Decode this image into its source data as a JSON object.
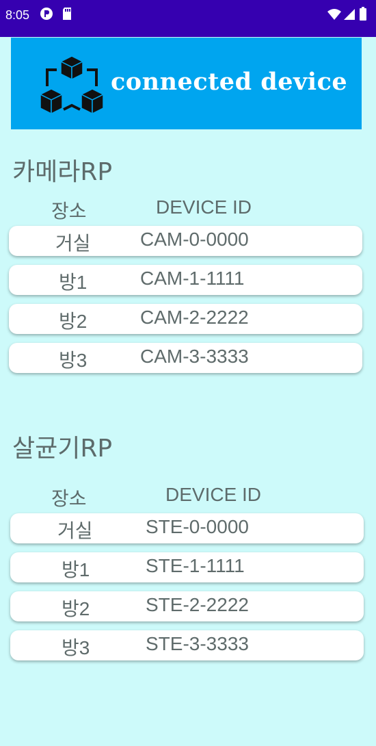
{
  "status_bar": {
    "time": "8:05",
    "icons": [
      "notification-icon",
      "sd-card-icon",
      "wifi-icon",
      "signal-icon",
      "battery-icon"
    ]
  },
  "banner": {
    "title": "connected device",
    "logo_icon": "network-cubes-icon",
    "background": "#00a5ef"
  },
  "camera": {
    "title": "카메라RP",
    "col_place": "장소",
    "col_device": "DEVICE ID",
    "rows": [
      {
        "place": "거실",
        "device": "CAM-0-0000"
      },
      {
        "place": "방1",
        "device": "CAM-1-1111"
      },
      {
        "place": "방2",
        "device": "CAM-2-2222"
      },
      {
        "place": "방3",
        "device": "CAM-3-3333"
      }
    ]
  },
  "sterilizer": {
    "title": "살균기RP",
    "col_place": "장소",
    "col_device": "DEVICE ID",
    "rows": [
      {
        "place": "거실",
        "device": "STE-0-0000"
      },
      {
        "place": "방1",
        "device": "STE-1-1111"
      },
      {
        "place": "방2",
        "device": "STE-2-2222"
      },
      {
        "place": "방3",
        "device": "STE-3-3333"
      }
    ]
  },
  "colors": {
    "status_bar": "#3600b0",
    "page_background": "#cdfafa",
    "text": "#5d6b6b"
  }
}
